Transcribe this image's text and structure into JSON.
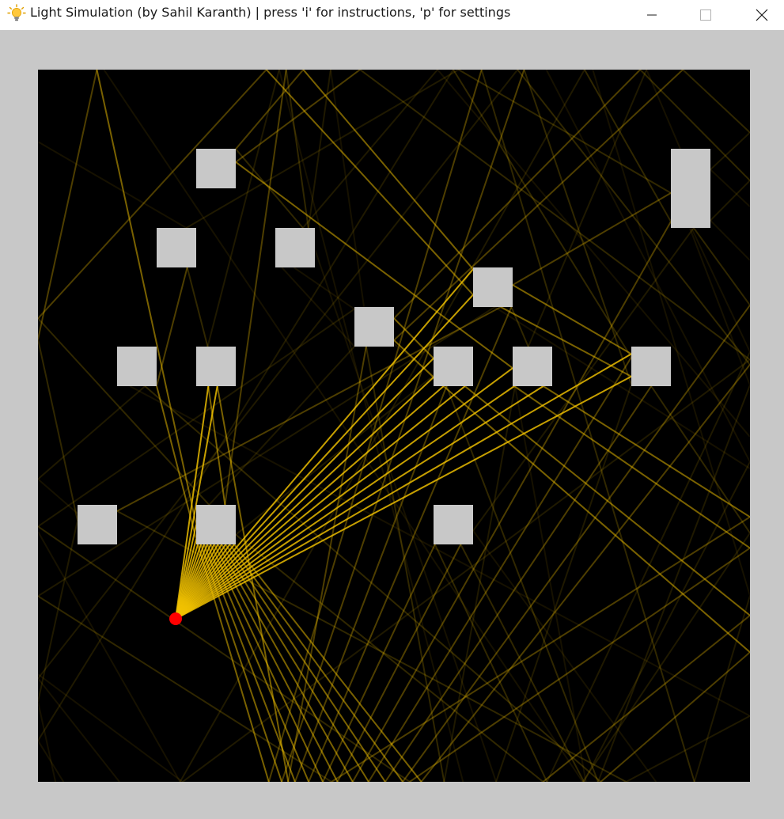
{
  "window": {
    "title": "Light Simulation (by Sahil Karanth) | press 'i' for instructions, 'p' for settings",
    "icon": "lightbulb-icon",
    "controls": [
      "minimize-icon",
      "maximize-icon",
      "close-icon"
    ]
  },
  "colors": {
    "frame": "#c8c8c8",
    "canvas": "#000000",
    "obstacle": "#c8c8c8",
    "ray": "#f2c200",
    "light_source": "#ff0000"
  },
  "grid": {
    "columns": 18,
    "rows": 18
  },
  "obstacles": [
    {
      "col": 4,
      "row": 2,
      "w": 1,
      "h": 1
    },
    {
      "col": 16,
      "row": 2,
      "w": 1,
      "h": 2
    },
    {
      "col": 3,
      "row": 4,
      "w": 1,
      "h": 1
    },
    {
      "col": 6,
      "row": 4,
      "w": 1,
      "h": 1
    },
    {
      "col": 11,
      "row": 5,
      "w": 1,
      "h": 1
    },
    {
      "col": 8,
      "row": 6,
      "w": 1,
      "h": 1
    },
    {
      "col": 2,
      "row": 7,
      "w": 1,
      "h": 1
    },
    {
      "col": 4,
      "row": 7,
      "w": 1,
      "h": 1
    },
    {
      "col": 10,
      "row": 7,
      "w": 1,
      "h": 1
    },
    {
      "col": 12,
      "row": 7,
      "w": 1,
      "h": 1
    },
    {
      "col": 15,
      "row": 7,
      "w": 1,
      "h": 1
    },
    {
      "col": 1,
      "row": 11,
      "w": 1,
      "h": 1
    },
    {
      "col": 4,
      "row": 11,
      "w": 1,
      "h": 1
    },
    {
      "col": 10,
      "row": 11,
      "w": 1,
      "h": 1
    }
  ],
  "light_source": {
    "col": 3.48,
    "row": 13.88
  }
}
